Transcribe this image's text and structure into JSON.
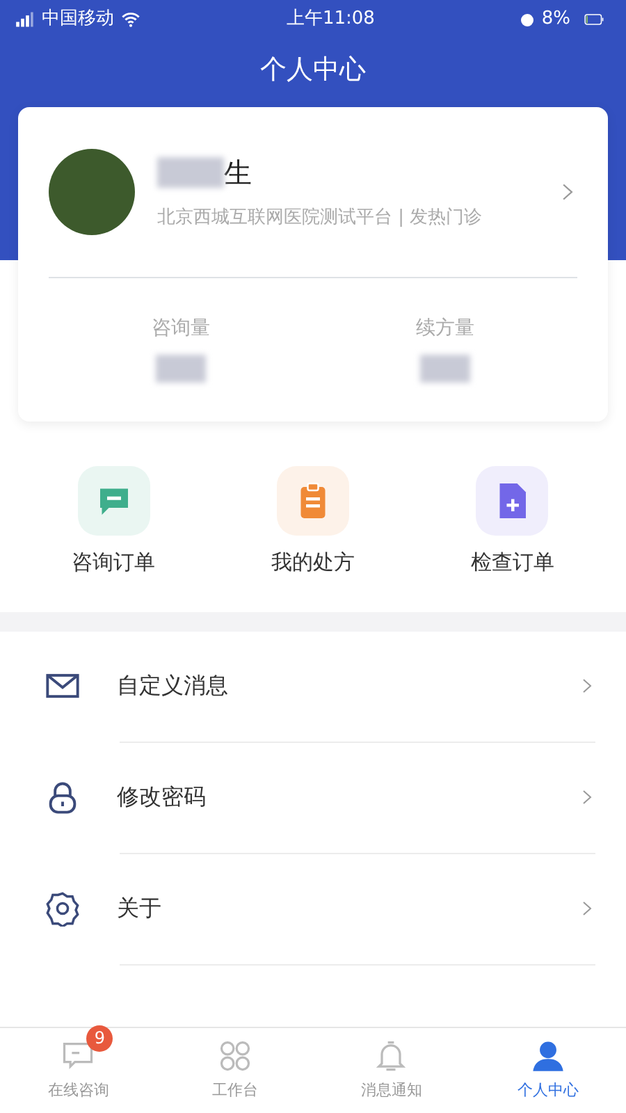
{
  "status_bar": {
    "carrier": "中国移动",
    "time": "上午11:08",
    "battery": "8%"
  },
  "title": "个人中心",
  "profile": {
    "name_visible": "生",
    "hospital": "北京西城互联网医院测试平台 | 发热门诊"
  },
  "stats": [
    {
      "label": "咨询量"
    },
    {
      "label": "续方量"
    }
  ],
  "shortcuts": [
    {
      "kind": "chat",
      "label": "咨询订单",
      "color": "#3fae8c"
    },
    {
      "kind": "clipboard",
      "label": "我的处方",
      "color": "#f08a37"
    },
    {
      "kind": "document",
      "label": "检查订单",
      "color": "#7367e8"
    }
  ],
  "menu": [
    {
      "kind": "mail",
      "label": "自定义消息"
    },
    {
      "kind": "lock",
      "label": "修改密码"
    },
    {
      "kind": "gear",
      "label": "关于"
    }
  ],
  "tabs": [
    {
      "kind": "chat",
      "label": "在线咨询",
      "selected": false,
      "badge": "9"
    },
    {
      "kind": "grid",
      "label": "工作台",
      "selected": false
    },
    {
      "kind": "bell",
      "label": "消息通知",
      "selected": false
    },
    {
      "kind": "person",
      "label": "个人中心",
      "selected": true
    }
  ]
}
